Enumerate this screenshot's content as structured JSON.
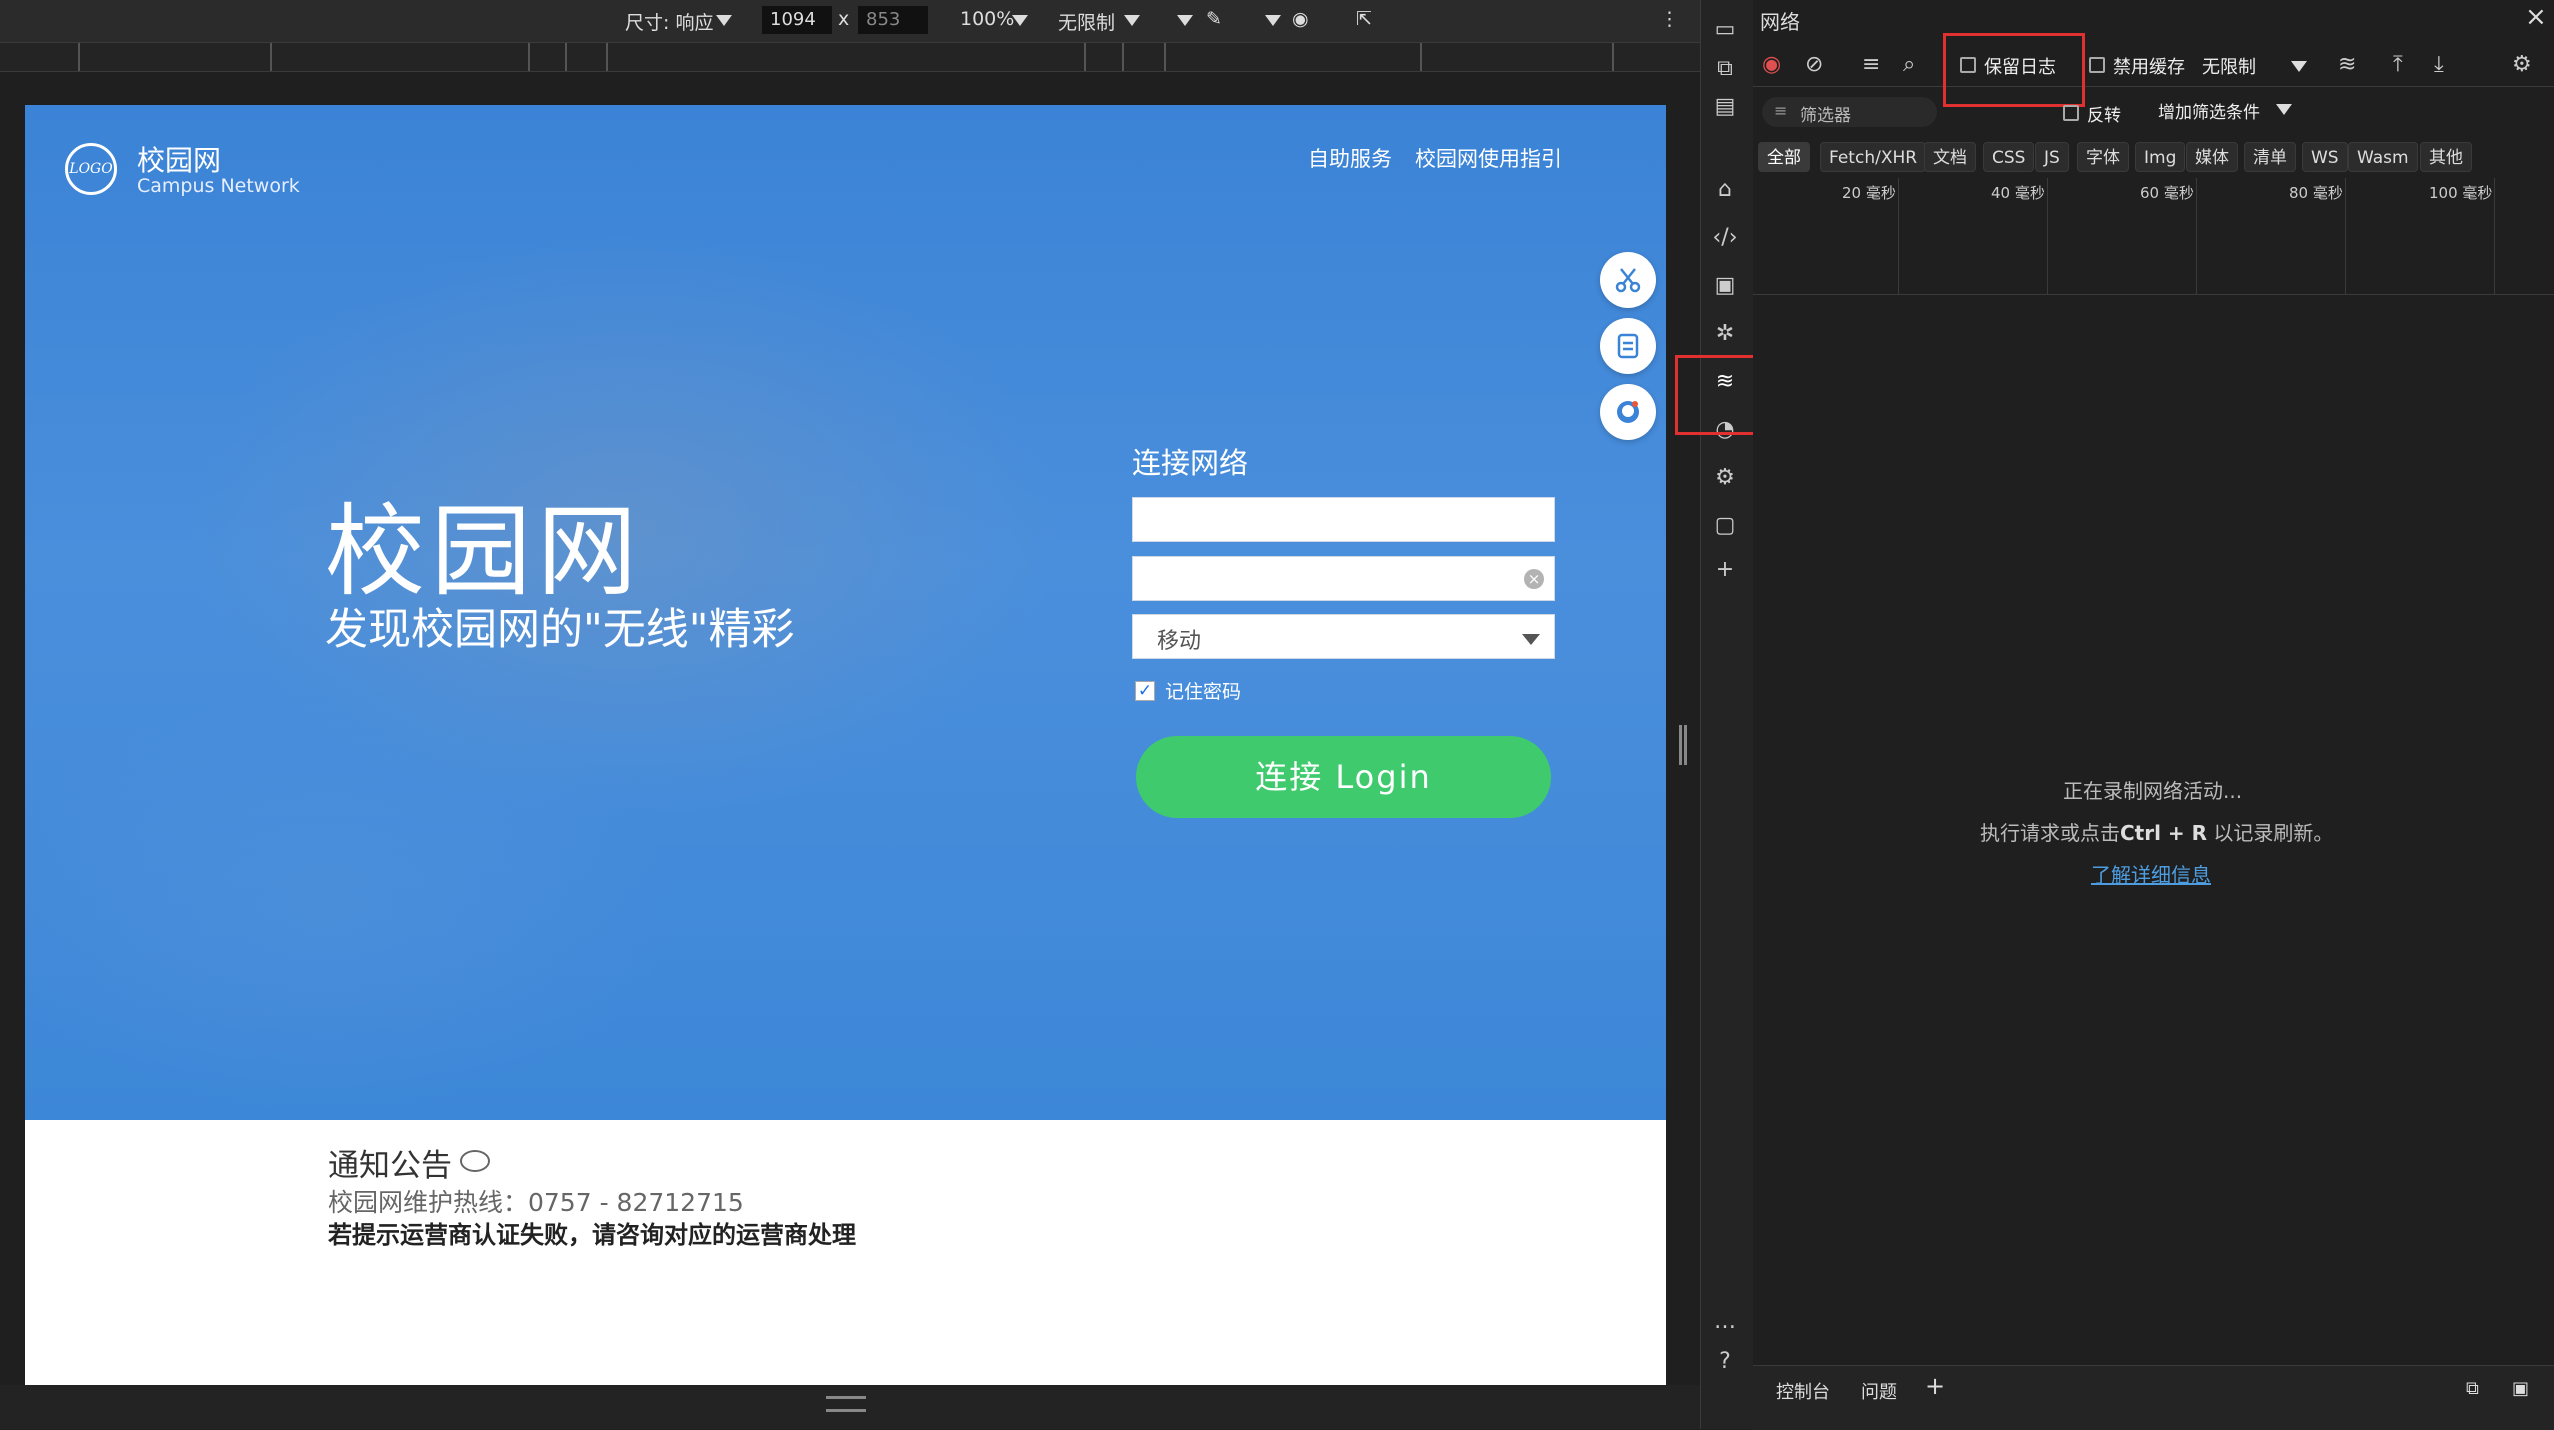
{
  "device_toolbar": {
    "dimensions_label": "尺寸: 响应",
    "width": "1094",
    "times": "x",
    "height": "853",
    "zoom": "100%",
    "throttle": "无限制"
  },
  "page": {
    "logo_text": "LOGO",
    "brand_cn": "校园网",
    "brand_en": "Campus Network",
    "nav": [
      "自助服务",
      "校园网使用指引"
    ],
    "hero_title": "校园网",
    "hero_subtitle": "发现校园网的\"无线\"精彩",
    "form": {
      "title": "连接网络",
      "username_value": "",
      "password_value": "",
      "carrier_selected": "移动",
      "remember_label": "记住密码",
      "remember_checked": true,
      "login_label": "连接 Login"
    },
    "notice": {
      "title": "通知公告",
      "hotline": "校园网维护热线：0757 - 82712715",
      "warning": "若提示运营商认证失败，请咨询对应的运营商处理"
    }
  },
  "devtools": {
    "panel_title": "网络",
    "preserve_log": "保留日志",
    "disable_cache": "禁用缓存",
    "throttle": "无限制",
    "filter_placeholder": "筛选器",
    "invert": "反转",
    "more_filters": "增加筛选条件",
    "types": [
      "全部",
      "Fetch/XHR",
      "文档",
      "CSS",
      "JS",
      "字体",
      "Img",
      "媒体",
      "清单",
      "WS",
      "Wasm",
      "其他"
    ],
    "ticks": [
      "20 毫秒",
      "40 毫秒",
      "60 毫秒",
      "80 毫秒",
      "100 毫秒"
    ],
    "empty_line1": "正在录制网络活动...",
    "empty_line2_prefix": "执行请求或点击",
    "empty_shortcut": "Ctrl + R",
    "empty_line2_suffix": "以记录刷新。",
    "learn_more": "了解详细信息",
    "drawer_tabs": [
      "控制台",
      "问题"
    ]
  },
  "colors": {
    "hero_blue": "#4a8fdc",
    "login_green": "#3fcb6d",
    "highlight_red": "#e03030",
    "link_blue": "#4d9de0"
  }
}
